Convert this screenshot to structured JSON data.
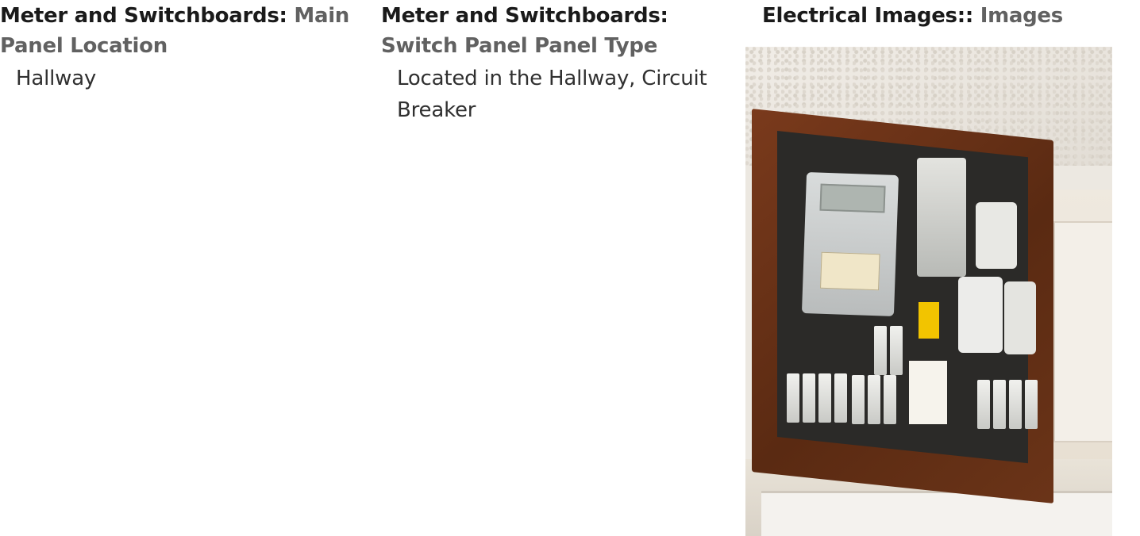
{
  "columns": [
    {
      "heading_main": "Meter and Switchboards:",
      "heading_sub": "Main Panel Location",
      "value": "Hallway"
    },
    {
      "heading_main": "Meter and Switchboards:",
      "heading_sub": "Switch Panel Panel Type",
      "value": "Located in the Hallway, Circuit Breaker"
    },
    {
      "heading_main": "Electrical Images::",
      "heading_sub": "Images"
    }
  ],
  "colors": {
    "heading_main": "#1a1a1a",
    "heading_sub": "#616161",
    "value_text": "#303030",
    "frame_wood": "#6b3418"
  }
}
